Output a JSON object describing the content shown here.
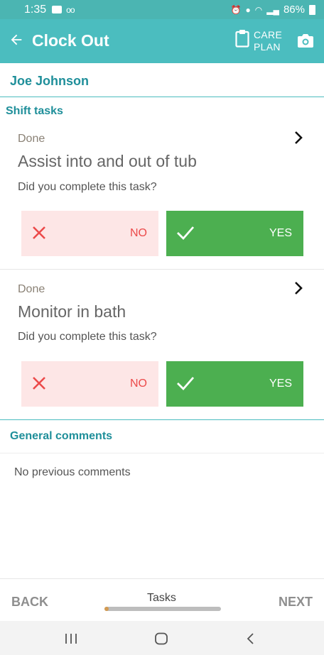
{
  "status_bar": {
    "time": "1:35",
    "voicemail": "oo",
    "battery": "86%"
  },
  "app_bar": {
    "title": "Clock Out",
    "care_plan_line1": "CARE",
    "care_plan_line2": "PLAN"
  },
  "patient": {
    "name": "Joe Johnson"
  },
  "shift_tasks": {
    "title": "Shift tasks",
    "tasks": [
      {
        "status": "Done",
        "name": "Assist into and out of tub",
        "question": "Did you complete this task?",
        "no_label": "NO",
        "yes_label": "YES"
      },
      {
        "status": "Done",
        "name": "Monitor in bath",
        "question": "Did you complete this task?",
        "no_label": "NO",
        "yes_label": "YES"
      }
    ]
  },
  "general_comments": {
    "title": "General comments",
    "empty_text": "No previous comments"
  },
  "bottom_bar": {
    "back_label": "BACK",
    "tab_label": "Tasks",
    "next_label": "NEXT"
  },
  "colors": {
    "accent": "#4bbdbf",
    "yes_green": "#4caf50",
    "no_red": "#ec4a4a",
    "no_bg": "#fde6e6"
  }
}
